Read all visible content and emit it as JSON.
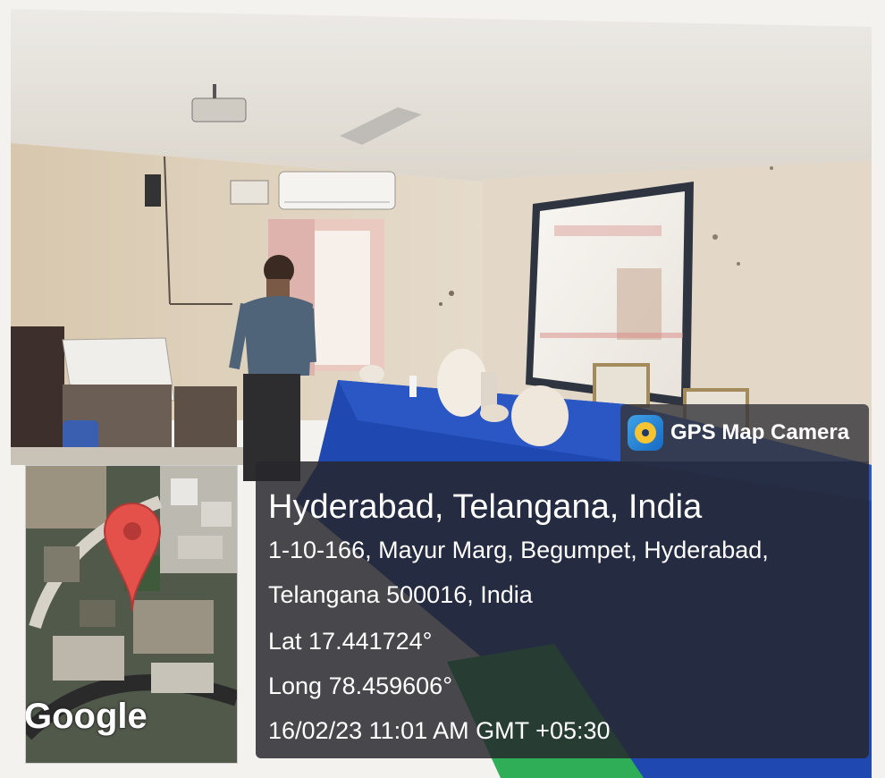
{
  "overlay": {
    "app_name": "GPS Map Camera",
    "app_icon": "gps-map-camera-app-icon",
    "place": "Hyderabad, Telangana, India",
    "address_line1": "1-10-166, Mayur Marg, Begumpet, Hyderabad,",
    "address_line2": "Telangana 500016, India",
    "latitude": "Lat 17.441724°",
    "longitude": "Long 78.459606°",
    "datetime": "16/02/23 11:01 AM GMT +05:30"
  },
  "map": {
    "attribution": "Google",
    "pin_icon": "map-pin-icon",
    "pin_color": "#e4504a"
  }
}
